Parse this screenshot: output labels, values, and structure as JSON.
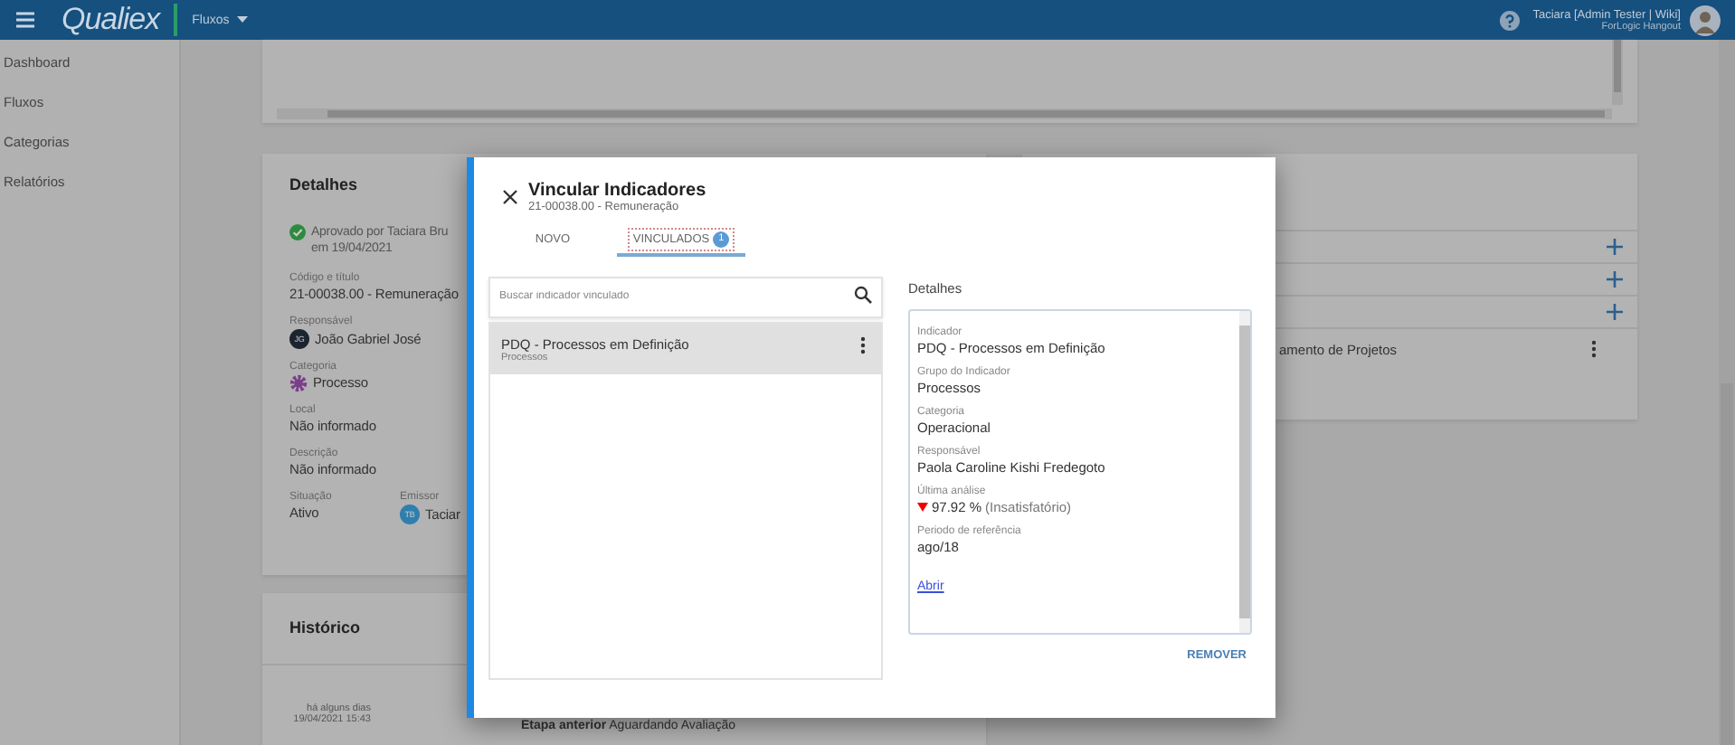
{
  "header": {
    "app_name": "Qualiex",
    "module_menu": "Fluxos",
    "user_name": "Taciara [Admin Tester | Wiki]",
    "user_org": "ForLogic Hangout"
  },
  "sidebar": {
    "items": [
      "Dashboard",
      "Fluxos",
      "Categorias",
      "Relatórios"
    ]
  },
  "details_card": {
    "title": "Detalhes",
    "approval": "Aprovado por Taciara Bru",
    "approval_date": "em 19/04/2021",
    "fields": [
      {
        "kind": "text",
        "label": "Código e título",
        "value": "21-00038.00 - Remuneração"
      },
      {
        "kind": "person",
        "label": "Responsável",
        "initials": "JG",
        "value": "João Gabriel José"
      },
      {
        "kind": "category",
        "label": "Categoria",
        "value": "Processo"
      },
      {
        "kind": "text",
        "label": "Local",
        "value": "Não informado"
      },
      {
        "kind": "text",
        "label": "Descrição",
        "value": "Não informado"
      }
    ],
    "status": {
      "label": "Situação",
      "value": "Ativo"
    },
    "issuer": {
      "label": "Emissor",
      "initials": "TB",
      "value": "Taciar"
    }
  },
  "history_card": {
    "title": "Histórico",
    "entries": [
      {
        "relative_time": "há alguns dias",
        "timestamp": "19/04/2021 15:43",
        "text": "**Etapa anterior** Aguardando Avaliação"
      }
    ]
  },
  "right_card": {
    "rows": [
      {
        "kind": "add"
      },
      {
        "kind": "add"
      },
      {
        "kind": "add"
      },
      {
        "kind": "item",
        "text": "amento de Projetos"
      }
    ]
  },
  "dialog": {
    "title": "Vincular Indicadores",
    "subtitle": "21-00038.00 - Remuneração",
    "tabs": [
      {
        "label": "NOVO",
        "selected": false
      },
      {
        "label": "VINCULADOS",
        "badge": "1",
        "selected": true
      }
    ],
    "search": {
      "placeholder": "Buscar indicador vinculado"
    },
    "indicators": [
      {
        "name": "PDQ - Processos em Definição",
        "group": "Processos",
        "selected": true
      }
    ],
    "details_title": "Detalhes",
    "details": [
      {
        "kind": "text",
        "label": "Indicador",
        "value": "PDQ - Processos em Definição"
      },
      {
        "kind": "text",
        "label": "Grupo do Indicador",
        "value": "Processos"
      },
      {
        "kind": "text",
        "label": "Categoria",
        "value": "Operacional"
      },
      {
        "kind": "text",
        "label": "Responsável",
        "value": "Paola Caroline Kishi Fredegoto"
      },
      {
        "kind": "analysis",
        "label": "Última análise",
        "value": "97.92 %",
        "note": "(Insatisfatório)",
        "declining": true
      },
      {
        "kind": "text",
        "label": "Periodo de referência",
        "value": "ago/18"
      }
    ],
    "open_link": "Abrir",
    "remove_button": "REMOVER"
  }
}
